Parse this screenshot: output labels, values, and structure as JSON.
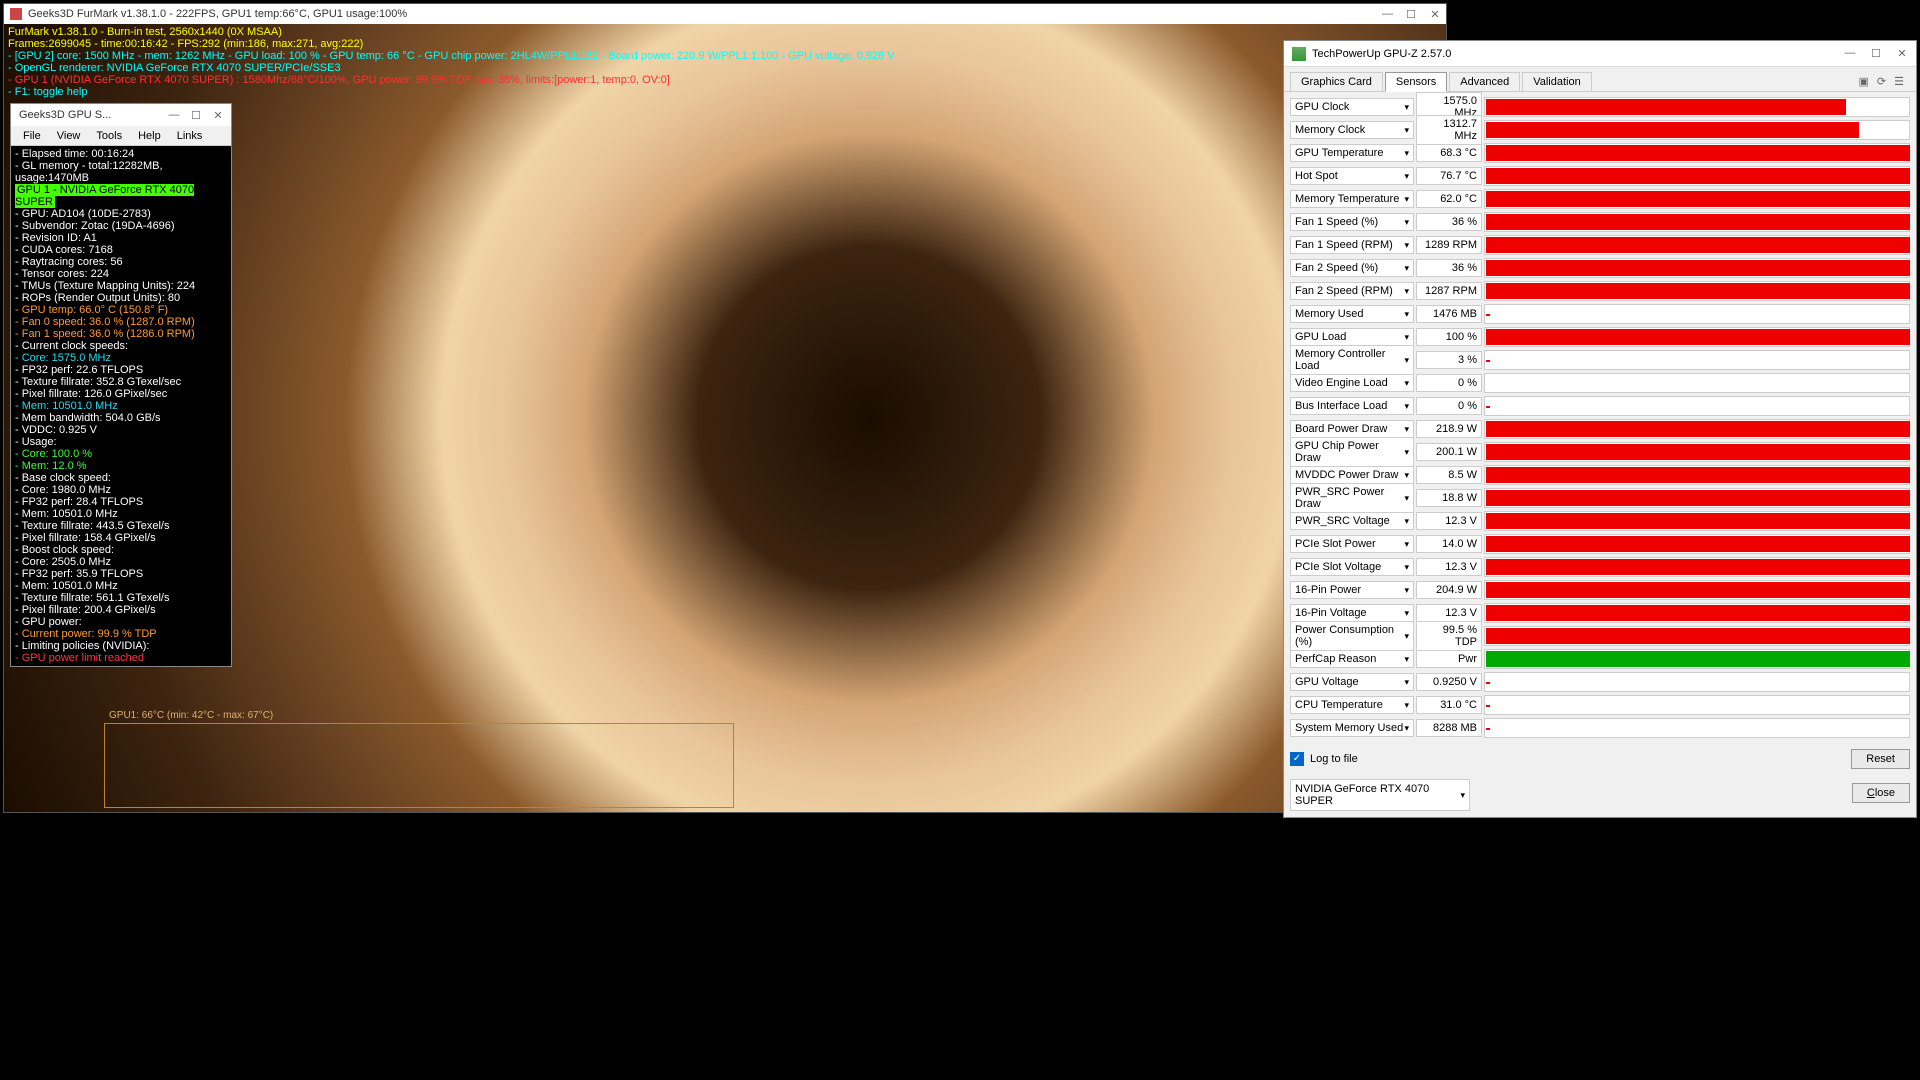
{
  "furmark": {
    "title": "Geeks3D FurMark v1.38.1.0 - 222FPS, GPU1 temp:66°C, GPU1 usage:100%",
    "sys_min": "—",
    "sys_max": "☐",
    "sys_close": "✕",
    "line1": "FurMark v1.38.1.0 - Burn-in test, 2560x1440 (0X MSAA)",
    "line2": "Frames:2699045 - time:00:16:42 - FPS:292 (min:186, max:271, avg:222)",
    "line3": "- [GPU 2] core: 1500 MHz - mem: 1262 MHz - GPU load: 100 % - GPU temp: 66 °C - GPU chip power: 2HL4W/PPL1:182 - Board power: 220.9 W/PPL1:1.100 - GPU voltage: 0.926 V",
    "line4": "- OpenGL renderer: NVIDIA GeForce RTX 4070 SUPER/PCIe/SSE3",
    "line5": "- GPU 1 (NVIDIA GeForce RTX 4070 SUPER) : 1580Mhz/68°C/100%, GPU power: 99.9% TDP, fan: 38%, limits:[power:1, temp:0, OV:0]",
    "line6": "- F1: toggle help",
    "graph_label": "GPU1: 66°C (min: 42°C - max: 67°C)"
  },
  "shark": {
    "title": "Geeks3D GPU S...",
    "menu": {
      "file": "File",
      "view": "View",
      "tools": "Tools",
      "help": "Help",
      "links": "Links"
    },
    "lines": [
      {
        "c": "sh-w",
        "t": "- Elapsed time: 00:16:24"
      },
      {
        "c": "sh-w",
        "t": "- GL memory - total:12282MB, usage:1470MB"
      },
      {
        "c": "sh-hl",
        "t": "GPU 1 - NVIDIA GeForce RTX 4070 SUPER"
      },
      {
        "c": "sh-w",
        "t": "- GPU: AD104 (10DE-2783)"
      },
      {
        "c": "sh-w",
        "t": "- Subvendor: Zotac (19DA-4696)"
      },
      {
        "c": "sh-w",
        "t": "- Revision ID: A1"
      },
      {
        "c": "sh-w",
        "t": "- CUDA cores: 7168"
      },
      {
        "c": "sh-w",
        "t": "- Raytracing cores: 56"
      },
      {
        "c": "sh-w",
        "t": "- Tensor cores: 224"
      },
      {
        "c": "sh-w",
        "t": "- TMUs (Texture Mapping Units): 224"
      },
      {
        "c": "sh-w",
        "t": "- ROPs (Render Output Units): 80"
      },
      {
        "c": "sh-o",
        "t": "- GPU temp: 66.0°   C (150.8°  F)"
      },
      {
        "c": "sh-o",
        "t": "- Fan 0 speed: 36.0 % (1287.0 RPM)"
      },
      {
        "c": "sh-o",
        "t": "- Fan 1 speed: 36.0 % (1286.0 RPM)"
      },
      {
        "c": "sh-w",
        "t": "- Current clock speeds:"
      },
      {
        "c": "sh-c",
        "t": "  - Core: 1575.0 MHz"
      },
      {
        "c": "sh-w",
        "t": "  - FP32 perf: 22.6 TFLOPS"
      },
      {
        "c": "sh-w",
        "t": "  - Texture fillrate: 352.8 GTexel/sec"
      },
      {
        "c": "sh-w",
        "t": "  - Pixel fillrate: 126.0 GPixel/sec"
      },
      {
        "c": "sh-c",
        "t": "  - Mem: 10501.0 MHz"
      },
      {
        "c": "sh-w",
        "t": "  - Mem bandwidth: 504.0 GB/s"
      },
      {
        "c": "sh-w",
        "t": "  - VDDC: 0.925 V"
      },
      {
        "c": "sh-w",
        "t": "- Usage:"
      },
      {
        "c": "sh-g",
        "t": "  - Core: 100.0 %"
      },
      {
        "c": "sh-g",
        "t": "  - Mem: 12.0 %"
      },
      {
        "c": "sh-w",
        "t": "- Base clock speed:"
      },
      {
        "c": "sh-w",
        "t": "  - Core: 1980.0 MHz"
      },
      {
        "c": "sh-w",
        "t": "  - FP32 perf: 28.4 TFLOPS"
      },
      {
        "c": "sh-w",
        "t": "  - Mem: 10501.0 MHz"
      },
      {
        "c": "sh-w",
        "t": "  - Texture fillrate: 443.5 GTexel/s"
      },
      {
        "c": "sh-w",
        "t": "  - Pixel fillrate: 158.4 GPixel/s"
      },
      {
        "c": "sh-w",
        "t": "- Boost clock speed:"
      },
      {
        "c": "sh-w",
        "t": "  - Core: 2505.0 MHz"
      },
      {
        "c": "sh-w",
        "t": "  - FP32 perf: 35.9 TFLOPS"
      },
      {
        "c": "sh-w",
        "t": "  - Mem: 10501.0 MHz"
      },
      {
        "c": "sh-w",
        "t": "  - Texture fillrate: 561.1 GTexel/s"
      },
      {
        "c": "sh-w",
        "t": "  - Pixel fillrate: 200.4 GPixel/s"
      },
      {
        "c": "sh-w",
        "t": "- GPU power:"
      },
      {
        "c": "sh-o",
        "t": "  - Current power: 99.9 % TDP"
      },
      {
        "c": "sh-w",
        "t": "- Limiting policies (NVIDIA):"
      },
      {
        "c": "sh-r",
        "t": "  - GPU power limit reached"
      }
    ]
  },
  "gpuz": {
    "title": "TechPowerUp GPU-Z 2.57.0",
    "tabs": {
      "gc": "Graphics Card",
      "sensors": "Sensors",
      "adv": "Advanced",
      "val": "Validation"
    },
    "icons": {
      "cam": "▣",
      "refresh": "⟳",
      "menu": "☰"
    },
    "sensors": [
      {
        "n": "GPU Clock",
        "v": "1575.0 MHz",
        "p": 85
      },
      {
        "n": "Memory Clock",
        "v": "1312.7 MHz",
        "p": 88
      },
      {
        "n": "GPU Temperature",
        "v": "68.3 °C",
        "p": 100
      },
      {
        "n": "Hot Spot",
        "v": "76.7 °C",
        "p": 100
      },
      {
        "n": "Memory Temperature",
        "v": "62.0 °C",
        "p": 100
      },
      {
        "n": "Fan 1 Speed (%)",
        "v": "36 %",
        "p": 100
      },
      {
        "n": "Fan 1 Speed (RPM)",
        "v": "1289 RPM",
        "p": 100
      },
      {
        "n": "Fan 2 Speed (%)",
        "v": "36 %",
        "p": 100
      },
      {
        "n": "Fan 2 Speed (RPM)",
        "v": "1287 RPM",
        "p": 100
      },
      {
        "n": "Memory Used",
        "v": "1476 MB",
        "p": 1,
        "thin": true
      },
      {
        "n": "GPU Load",
        "v": "100 %",
        "p": 100
      },
      {
        "n": "Memory Controller Load",
        "v": "3 %",
        "p": 1,
        "thin": true
      },
      {
        "n": "Video Engine Load",
        "v": "0 %",
        "p": 0,
        "thin": true
      },
      {
        "n": "Bus Interface Load",
        "v": "0 %",
        "p": 1,
        "thin": true
      },
      {
        "n": "Board Power Draw",
        "v": "218.9 W",
        "p": 100
      },
      {
        "n": "GPU Chip Power Draw",
        "v": "200.1 W",
        "p": 100
      },
      {
        "n": "MVDDC Power Draw",
        "v": "8.5 W",
        "p": 100
      },
      {
        "n": "PWR_SRC Power Draw",
        "v": "18.8 W",
        "p": 100
      },
      {
        "n": "PWR_SRC Voltage",
        "v": "12.3 V",
        "p": 100
      },
      {
        "n": "PCIe Slot Power",
        "v": "14.0 W",
        "p": 100
      },
      {
        "n": "PCIe Slot Voltage",
        "v": "12.3 V",
        "p": 100
      },
      {
        "n": "16-Pin Power",
        "v": "204.9 W",
        "p": 100
      },
      {
        "n": "16-Pin Voltage",
        "v": "12.3 V",
        "p": 100
      },
      {
        "n": "Power Consumption (%)",
        "v": "99.5 % TDP",
        "p": 100
      },
      {
        "n": "PerfCap Reason",
        "v": "Pwr",
        "p": 100,
        "green": true
      },
      {
        "n": "GPU Voltage",
        "v": "0.9250 V",
        "p": 1,
        "thin": true
      },
      {
        "n": "CPU Temperature",
        "v": "31.0 °C",
        "p": 1,
        "thin": true
      },
      {
        "n": "System Memory Used",
        "v": "8288 MB",
        "p": 1,
        "thin": true
      }
    ],
    "log": "Log to file",
    "reset": "Reset",
    "close": "Close",
    "gpu_select": "NVIDIA GeForce RTX 4070 SUPER"
  }
}
